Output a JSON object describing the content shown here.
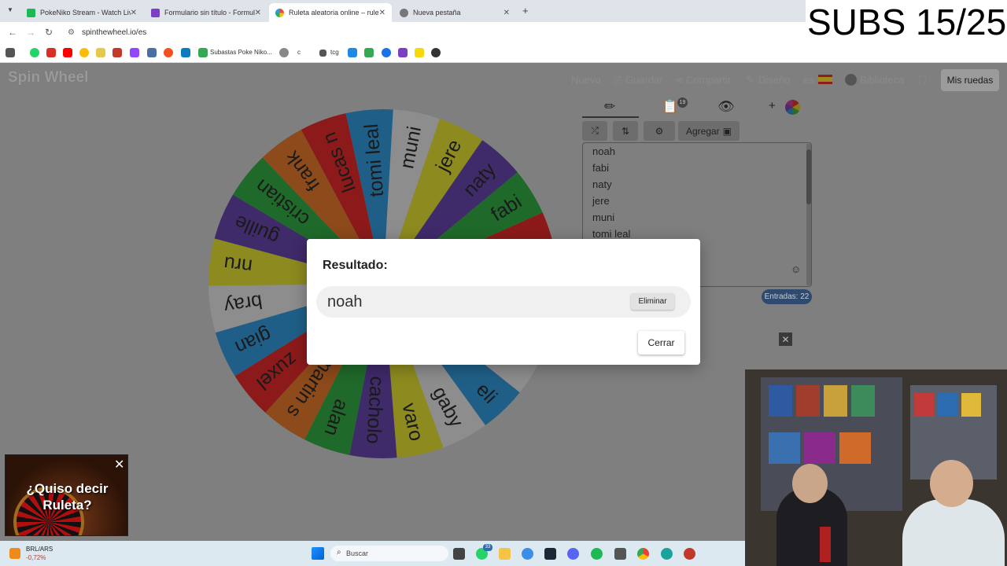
{
  "browser": {
    "tabs": [
      {
        "label": "PokeNiko Stream - Watch Live o",
        "color": "#1db954"
      },
      {
        "label": "Formulario sin título - Formular",
        "color": "#7b3fc4"
      },
      {
        "label": "Ruleta aleatoria online – ruleta",
        "color": "#e84c3d"
      },
      {
        "label": "Nueva pestaña",
        "color": "#666666"
      }
    ],
    "url": "spinthewheel.io/es",
    "bookmark_label": "Subastas Poke Niko...",
    "bookmark_c": "c",
    "bookmark_tcg": "tcg"
  },
  "overlay": {
    "subs_counter": "SUBS 15/25"
  },
  "app": {
    "logo": "Spin Wheel",
    "nav": {
      "nuevo": "Nuevo",
      "guardar": "Guardar",
      "compartir": "Compartir",
      "diseno": "Diseño",
      "lang": "es",
      "biblioteca": "Biblioteca",
      "mis_ruedas": "Mis ruedas"
    },
    "tools": {
      "badge": "19",
      "plus": "+"
    },
    "agregar_label": "Agregar",
    "entries": [
      "noah",
      "fabi",
      "naty",
      "jere",
      "muni",
      "tomi leal"
    ],
    "entries_count": "Entradas: 22",
    "wheel_labels": [
      "lucas n",
      "tomi leal",
      "muni",
      "jere",
      "naty",
      "fabi",
      "",
      "",
      "",
      "",
      "eli",
      "gaby",
      "varo",
      "cacholo",
      "alan",
      "martin s",
      "zuxel",
      "gian",
      "bray",
      "nru",
      "guille",
      "cristian",
      "frank"
    ]
  },
  "modal": {
    "title": "Resultado:",
    "result": "noah",
    "remove_label": "Eliminar",
    "close_label": "Cerrar"
  },
  "ad": {
    "text_line1": "¿Quiso decir",
    "text_line2": "Ruleta?"
  },
  "taskbar": {
    "ticker_name": "BRL/ARS",
    "ticker_change": "-0,72%",
    "search_placeholder": "Buscar",
    "whatsapp_badge": "33"
  }
}
